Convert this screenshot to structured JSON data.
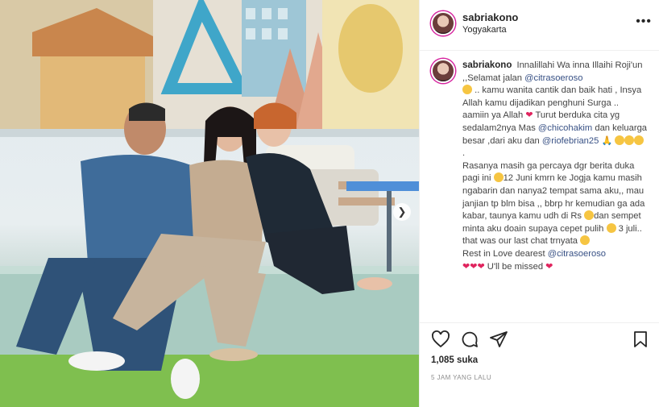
{
  "post": {
    "username": "sabriakono",
    "location": "Yogyakarta",
    "likes": "1,085 suka",
    "timestamp": "5 JAM YANG LALU"
  },
  "caption": {
    "username": "sabriakono",
    "t1": "Innalillahi Wa inna Illaihi Roji'un ,,Selamat jalan ",
    "m1": "@citrasoeroso",
    "t2": " .. kamu wanita cantik dan baik hati , Insya Allah kamu dijadikan penghuni Surga .. aamiin ya Allah ",
    "t3": " Turut berduka cita yg sedalam2nya Mas ",
    "m2": "@chicohakim",
    "t4": " dan keluarga besar ,dari aku dan ",
    "m3": "@riofebrian25",
    "t5": "\n.\nRasanya masih ga percaya dgr berita duka pagi ini ",
    "t6": "12 Juni kmrn ke Jogja kamu masih ngabarin dan nanya2 tempat sama aku,, mau janjian tp blm bisa ,, bbrp hr kemudian ga ada kabar, taunya kamu udh di Rs ",
    "t7": "dan sempet minta aku doain supaya cepet pulih ",
    "t8": " 3 juli.. that was our last chat trnyata ",
    "t9": "\nRest in Love dearest ",
    "m4": "@citrasoeroso",
    "t10": "\n",
    "t11": " U'll be missed "
  },
  "icons": {
    "more": "more-options-icon",
    "like": "heart-icon",
    "comment": "comment-icon",
    "share": "share-icon",
    "save": "bookmark-icon",
    "next": "chevron-right-icon"
  },
  "colors": {
    "mention": "#385185",
    "heart": "#e0245e",
    "story_ring": "#d6249f"
  }
}
